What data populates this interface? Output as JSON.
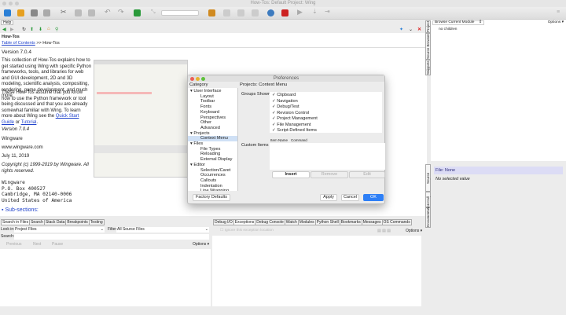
{
  "window": {
    "title": "How-Tos: Default Project: Wing"
  },
  "help": {
    "tab": "Help",
    "page_title": "How-Tos",
    "breadcrumb_link": "Table of Contents",
    "breadcrumb_rest": ">> How-Tos",
    "version": "Version 7.0.4",
    "para1": "This collection of How-Tos explains how to get started using Wing with specific Python frameworks, tools, and libraries for web and GUI development, 2D and 3D modeling, scientific analysis, compositing, rendering, game development, and much more.",
    "para2": "These How-Tos assume that you know how to use the Python framework or tool being discussed and that you are already somewhat familiar with Wing. To learn more about Wing see the",
    "quick_start": "Quick Start Guide",
    "or": "or",
    "tutorial": "Tutorial",
    "period": ".",
    "version2": "Version 7.0.4",
    "company": "Wingware",
    "url": "www.wingware.com",
    "date": "July 11, 2019",
    "copyright": "Copyright (c) 1999-2019 by Wingware. All rights reserved.",
    "address": [
      "Wingware",
      "P.O. Box 400527",
      "Cambridge, MA  02140-0006",
      "United States of America"
    ],
    "subsections": "Sub-sections:"
  },
  "prefs": {
    "title": "Preferences",
    "category_header": "Category",
    "section_title": "Projects: Context Menu",
    "groups_label": "Groups Shown",
    "categories": [
      {
        "label": "User Interface",
        "level": 0
      },
      {
        "label": "Layout",
        "level": 1
      },
      {
        "label": "Toolbar",
        "level": 1
      },
      {
        "label": "Fonts",
        "level": 1
      },
      {
        "label": "Keyboard",
        "level": 1
      },
      {
        "label": "Perspectives",
        "level": 1
      },
      {
        "label": "Other",
        "level": 1
      },
      {
        "label": "Advanced",
        "level": 1
      },
      {
        "label": "Projects",
        "level": 0
      },
      {
        "label": "Context Menu",
        "level": 1
      },
      {
        "label": "Files",
        "level": 0
      },
      {
        "label": "File Types",
        "level": 1
      },
      {
        "label": "Reloading",
        "level": 1
      },
      {
        "label": "External Display",
        "level": 1
      },
      {
        "label": "Editor",
        "level": 0
      },
      {
        "label": "Selection/Caret",
        "level": 1
      },
      {
        "label": "Occurrences",
        "level": 1
      },
      {
        "label": "Callouts",
        "level": 1
      },
      {
        "label": "Indentation",
        "level": 1
      },
      {
        "label": "Line Wrapping",
        "level": 1
      }
    ],
    "groups": [
      "Clipboard",
      "Navigation",
      "Debug/Test",
      "Revision Control",
      "Project Management",
      "File Management",
      "Script-Defined Items"
    ],
    "custom_label": "Custom Items",
    "col_item": "Item Name",
    "col_command": "Command",
    "insert": "Insert",
    "remove": "Remove",
    "edit": "Edit",
    "factory": "Factory Defaults",
    "apply": "Apply",
    "cancel": "Cancel",
    "ok": "OK"
  },
  "right": {
    "browse_select": "Browse Current Module",
    "options": "Options",
    "no_children": "no children",
    "file": "File: None",
    "no_value": "No selected value",
    "vtabs": [
      "Project",
      "Source Browser",
      "Snippets",
      "Source Assistant",
      "Call Stack",
      "Documentation"
    ]
  },
  "bottom_left": {
    "tabs": [
      "Search in Files",
      "Search",
      "Stack Data",
      "Breakpoints",
      "Testing"
    ],
    "look_in_label": "Look in:",
    "look_in": "Project Files",
    "filter_label": "Filter:",
    "filter": "All Source Files",
    "search_label": "Search:",
    "previous": "Previous",
    "next": "Next",
    "pause": "Pause",
    "options": "Options"
  },
  "bottom_right": {
    "tabs": [
      "Debug I/O",
      "Exceptions",
      "Debug Console",
      "Watch",
      "Modules",
      "Python Shell",
      "Bookmarks",
      "Messages",
      "OS Commands"
    ],
    "ignore": "Ignore this exception location",
    "options": "Options"
  }
}
